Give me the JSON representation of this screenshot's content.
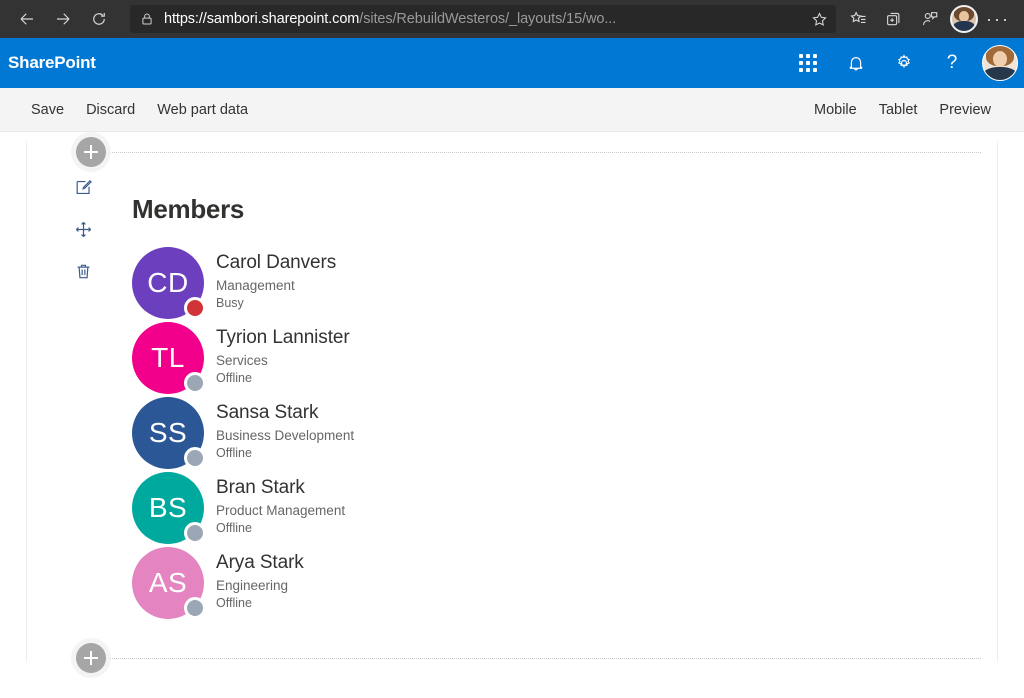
{
  "browser": {
    "back_icon": "back-arrow-icon",
    "forward_icon": "forward-arrow-icon",
    "refresh_icon": "refresh-icon",
    "lock_icon": "lock-icon",
    "url_host": "https://sambori.sharepoint.com",
    "url_path": "/sites/RebuildWesteros/_layouts/15/wo...",
    "favorite_icon": "star-icon",
    "toolbar_icons": [
      "favorites-hub-icon",
      "collections-icon",
      "share-person-icon"
    ],
    "profile_icon": "browser-profile-avatar",
    "more_label": "···"
  },
  "suite": {
    "brand": "SharePoint",
    "waffle_icon": "app-launcher-icon",
    "bell_icon": "notifications-icon",
    "gear_icon": "settings-icon",
    "help_label": "?",
    "avatar_icon": "user-avatar"
  },
  "commandbar": {
    "left": [
      {
        "label": "Save",
        "name": "save-button"
      },
      {
        "label": "Discard",
        "name": "discard-button"
      },
      {
        "label": "Web part data",
        "name": "web-part-data-button"
      }
    ],
    "right": [
      {
        "label": "Mobile",
        "name": "mobile-preview-button"
      },
      {
        "label": "Tablet",
        "name": "tablet-preview-button"
      },
      {
        "label": "Preview",
        "name": "preview-button"
      }
    ]
  },
  "canvas": {
    "add_section_top_icon": "add-section-icon",
    "add_section_bottom_icon": "add-section-icon",
    "tools": [
      {
        "name": "edit-webpart-icon",
        "label": "edit"
      },
      {
        "name": "move-webpart-icon",
        "label": "move"
      },
      {
        "name": "delete-webpart-icon",
        "label": "delete"
      }
    ]
  },
  "webpart": {
    "title": "Members",
    "members": [
      {
        "initials": "CD",
        "name": "Carol Danvers",
        "role": "Management",
        "status": "Busy",
        "avatar_color": "#6B3FBD",
        "presence_color": "#D13438"
      },
      {
        "initials": "TL",
        "name": "Tyrion Lannister",
        "role": "Services",
        "status": "Offline",
        "avatar_color": "#F2008C",
        "presence_color": "#9BA7B5"
      },
      {
        "initials": "SS",
        "name": "Sansa Stark",
        "role": "Business Development",
        "status": "Offline",
        "avatar_color": "#2B5797",
        "presence_color": "#9BA7B5"
      },
      {
        "initials": "BS",
        "name": "Bran Stark",
        "role": "Product Management",
        "status": "Offline",
        "avatar_color": "#00A99D",
        "presence_color": "#9BA7B5"
      },
      {
        "initials": "AS",
        "name": "Arya Stark",
        "role": "Engineering",
        "status": "Offline",
        "avatar_color": "#E484C0",
        "presence_color": "#9BA7B5"
      }
    ]
  },
  "colors": {
    "suite_blue": "#0078D4",
    "command_bar_bg": "#F4F4F4",
    "browser_bg": "#333333"
  }
}
